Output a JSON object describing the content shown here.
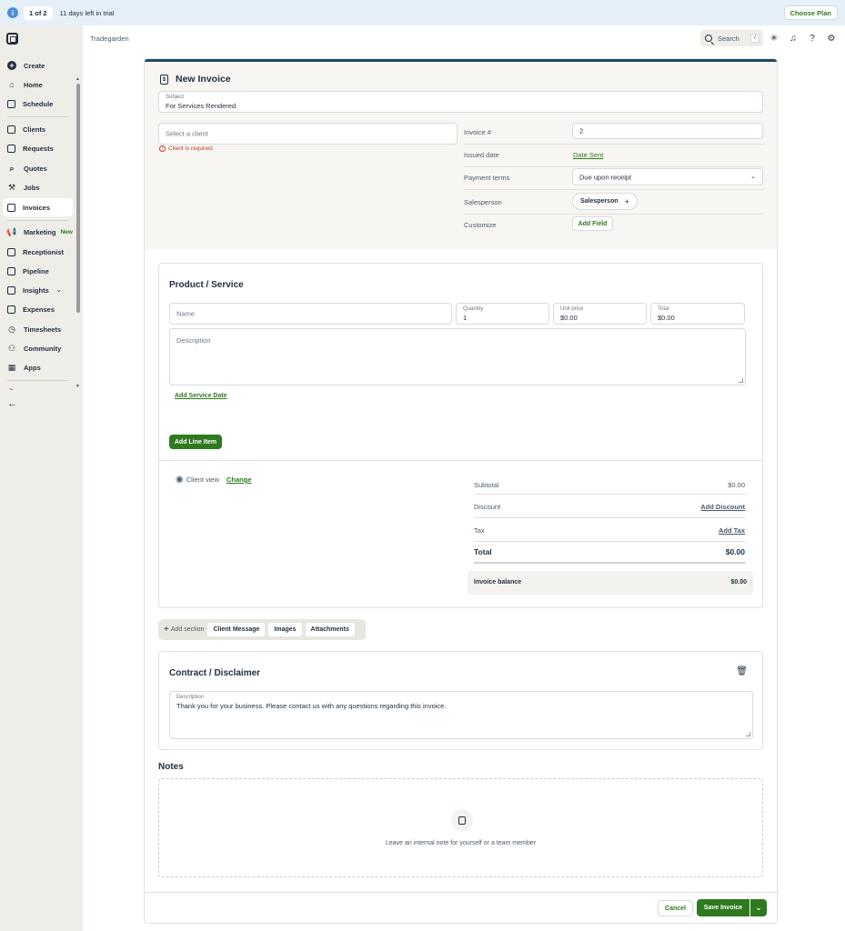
{
  "banner": {
    "count": "1 of 2",
    "days_left": "11 days left in trial",
    "choose_plan": "Choose Plan",
    "info_icon": "info-icon"
  },
  "sidebar": {
    "items": [
      {
        "label": "Create",
        "icon": "plus-circle-icon"
      },
      {
        "label": "Home",
        "icon": "home-icon"
      },
      {
        "label": "Schedule",
        "icon": "calendar-icon"
      },
      {
        "label": "Clients",
        "icon": "clients-icon"
      },
      {
        "label": "Requests",
        "icon": "inbox-icon"
      },
      {
        "label": "Quotes",
        "icon": "quote-icon"
      },
      {
        "label": "Jobs",
        "icon": "hammer-icon"
      },
      {
        "label": "Invoices",
        "icon": "invoice-icon"
      },
      {
        "label": "Marketing",
        "icon": "megaphone-icon",
        "badge": "New"
      },
      {
        "label": "Receptionist",
        "icon": "receptionist-icon"
      },
      {
        "label": "Pipeline",
        "icon": "pipeline-icon"
      },
      {
        "label": "Insights",
        "icon": "chart-icon"
      },
      {
        "label": "Expenses",
        "icon": "receipt-icon"
      },
      {
        "label": "Timesheets",
        "icon": "clock-icon"
      },
      {
        "label": "Community",
        "icon": "community-icon"
      },
      {
        "label": "Apps",
        "icon": "apps-icon"
      }
    ],
    "collapse": "←",
    "tilde": "~"
  },
  "topbar": {
    "company": "Tradegarden",
    "search_placeholder": "Search",
    "search_shortcut": "/"
  },
  "invoice": {
    "title": "New Invoice",
    "subject_label": "Subject",
    "subject_value": "For Services Rendered",
    "client_placeholder": "Select a client",
    "client_error": "Client is required",
    "details": {
      "invoice_no_label": "Invoice #",
      "invoice_no_value": "2",
      "issued_label": "Issued date",
      "issued_value": "Date Sent",
      "terms_label": "Payment terms",
      "terms_value": "Due upon receipt",
      "salesperson_label": "Salesperson",
      "salesperson_value": "Salesperson",
      "customize_label": "Customize",
      "customize_value": "Add Field"
    }
  },
  "product": {
    "title": "Product / Service",
    "name_placeholder": "Name",
    "quantity_label": "Quantity",
    "quantity_value": "1",
    "unit_price_label": "Unit price",
    "unit_price_value": "$0.00",
    "total_label": "Total",
    "total_value": "$0.00",
    "description_placeholder": "Description",
    "add_service_date": "Add Service Date",
    "add_line_item": "Add Line Item"
  },
  "totals": {
    "client_view": "Client view",
    "change": "Change",
    "subtotal_label": "Subtotal",
    "subtotal_value": "$0.00",
    "discount_label": "Discount",
    "discount_value": "Add Discount",
    "tax_label": "Tax",
    "tax_value": "Add Tax",
    "total_label": "Total",
    "total_value": "$0.00",
    "balance_label": "Invoice balance",
    "balance_value": "$0.00"
  },
  "add_section": {
    "label": "Add section",
    "chips": [
      "Client Message",
      "Images",
      "Attachments"
    ]
  },
  "contract": {
    "title": "Contract / Disclaimer",
    "desc_label": "Description",
    "desc_value": "Thank you for your business. Please contact us with any questions regarding this invoice."
  },
  "notes": {
    "title": "Notes",
    "hint": "Leave an internal note for yourself or a team member"
  },
  "footer": {
    "cancel": "Cancel",
    "save": "Save Invoice"
  },
  "colors": {
    "brand_green": "#2f7a1f",
    "navy": "#1f4a63",
    "error": "#c23a2b"
  }
}
